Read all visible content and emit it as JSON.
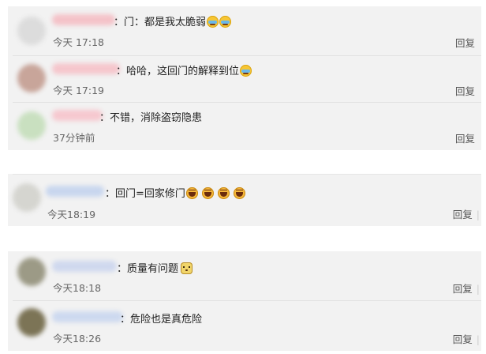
{
  "groups": [
    {
      "comments": [
        {
          "text": "：门：都是我太脆弱",
          "emojis": [
            "cry-laugh",
            "cry-laugh"
          ],
          "time": "今天 17:18",
          "reply": "回复"
        },
        {
          "text": "：哈哈，这回门的解释到位",
          "emojis": [
            "cry-laugh"
          ],
          "time": "今天 17:19",
          "reply": "回复"
        },
        {
          "text": "：不错，消除盗窃隐患",
          "emojis": [],
          "time": "37分钟前",
          "reply": "回复"
        }
      ]
    },
    {
      "comments": [
        {
          "text": "：回门=回家修门",
          "emojis": [
            "laugh",
            "laugh",
            "laugh",
            "laugh"
          ],
          "time": "今天18:19",
          "reply": "回复"
        }
      ]
    },
    {
      "comments": [
        {
          "text": "：质量有问题",
          "emojis": [
            "doge"
          ],
          "time": "今天18:18",
          "reply": "回复"
        },
        {
          "text": "：危险也是真危险",
          "emojis": [],
          "time": "今天18:26",
          "reply": "回复"
        }
      ]
    }
  ],
  "colors": {
    "panel_bg": "#f2f2f2",
    "text": "#222222",
    "muted": "#666666"
  }
}
